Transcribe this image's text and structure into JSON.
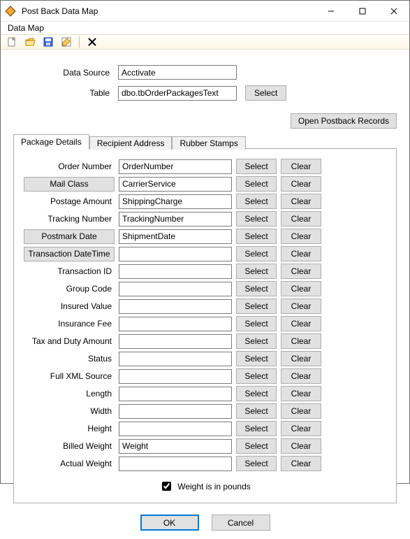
{
  "window": {
    "title": "Post Back Data Map",
    "min_tooltip": "Minimize",
    "max_tooltip": "Maximize",
    "close_tooltip": "Close"
  },
  "menu": {
    "data_map": "Data Map"
  },
  "toolbar": {
    "new_icon": "new-file-icon",
    "open_icon": "open-folder-icon",
    "save_icon": "save-disk-icon",
    "saveas_icon": "saveas-icon",
    "delete_icon": "delete-x-icon"
  },
  "top": {
    "data_source_label": "Data Source",
    "data_source_value": "Acctivate",
    "table_label": "Table",
    "table_value": "dbo.tbOrderPackagesText",
    "table_select_btn": "Select",
    "open_postback_btn": "Open Postback Records"
  },
  "tabs": {
    "package_details": "Package Details",
    "recipient_address": "Recipient Address",
    "rubber_stamps": "Rubber Stamps"
  },
  "buttons": {
    "select": "Select",
    "clear": "Clear",
    "ok": "OK",
    "cancel": "Cancel"
  },
  "checkbox": {
    "weight_pounds": "Weight is in pounds",
    "checked": true
  },
  "fields": [
    {
      "label": "Order Number",
      "value": "OrderNumber",
      "label_is_button": false
    },
    {
      "label": "Mail Class",
      "value": "CarrierService",
      "label_is_button": true
    },
    {
      "label": "Postage Amount",
      "value": "ShippingCharge",
      "label_is_button": false
    },
    {
      "label": "Tracking Number",
      "value": "TrackingNumber",
      "label_is_button": false
    },
    {
      "label": "Postmark Date",
      "value": "ShipmentDate",
      "label_is_button": true
    },
    {
      "label": "Transaction DateTime",
      "value": "",
      "label_is_button": true
    },
    {
      "label": "Transaction ID",
      "value": "",
      "label_is_button": false
    },
    {
      "label": "Group Code",
      "value": "",
      "label_is_button": false
    },
    {
      "label": "Insured Value",
      "value": "",
      "label_is_button": false
    },
    {
      "label": "Insurance Fee",
      "value": "",
      "label_is_button": false
    },
    {
      "label": "Tax and Duty Amount",
      "value": "",
      "label_is_button": false
    },
    {
      "label": "Status",
      "value": "",
      "label_is_button": false
    },
    {
      "label": "Full XML Source",
      "value": "",
      "label_is_button": false
    },
    {
      "label": "Length",
      "value": "",
      "label_is_button": false
    },
    {
      "label": "Width",
      "value": "",
      "label_is_button": false
    },
    {
      "label": "Height",
      "value": "",
      "label_is_button": false
    },
    {
      "label": "Billed Weight",
      "value": "Weight",
      "label_is_button": false
    },
    {
      "label": "Actual Weight",
      "value": "",
      "label_is_button": false
    }
  ]
}
